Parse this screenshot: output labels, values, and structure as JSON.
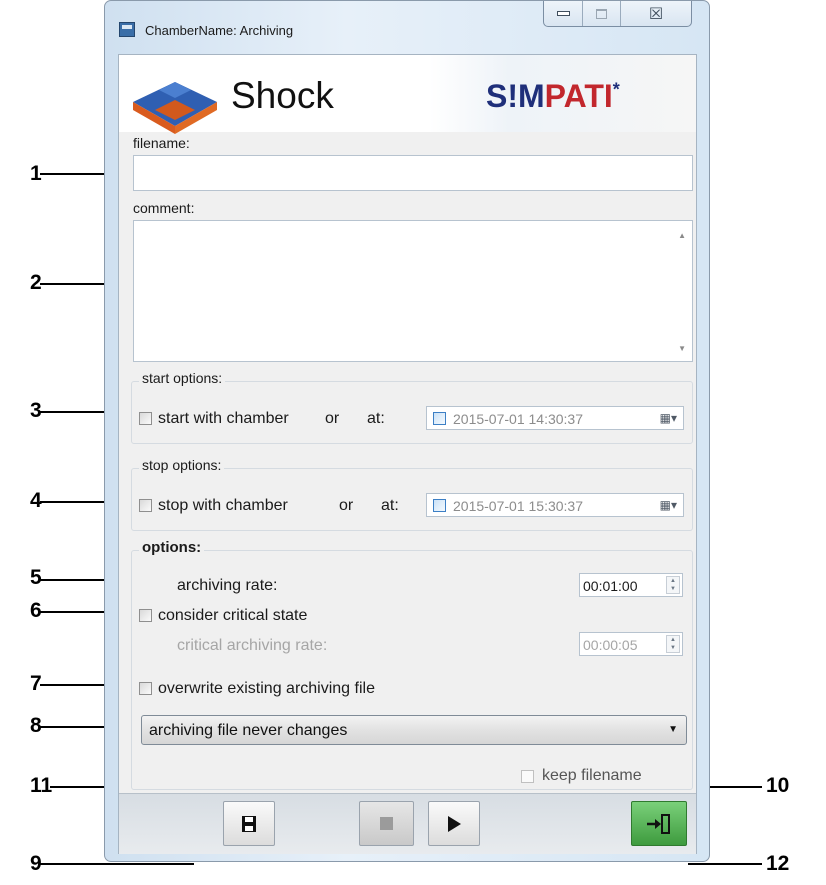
{
  "window": {
    "title": "ChamberName: Archiving",
    "icon": "floppy-window-icon",
    "controls": {
      "minimize": "minimize-icon",
      "maximize": "maximize-icon",
      "close_glyph": "☒"
    }
  },
  "banner": {
    "app_name": "Shock",
    "brand_part1": "S!M",
    "brand_part2": "PATI",
    "brand_mark": "*"
  },
  "fields": {
    "filename_label": "filename:",
    "filename_value": "",
    "comment_label": "comment:",
    "comment_value": ""
  },
  "start_options": {
    "title": "start options:",
    "checkbox_label": "start with chamber",
    "or_label": "or",
    "at_label": "at:",
    "datetime": "2015-07-01  14:30:37"
  },
  "stop_options": {
    "title": "stop options:",
    "checkbox_label": "stop with chamber",
    "or_label": "or",
    "at_label": "at:",
    "datetime": "2015-07-01 15:30:37"
  },
  "options": {
    "title": "options:",
    "archiving_rate_label": "archiving rate:",
    "archiving_rate_value": "00:01:00",
    "consider_critical_label": "consider critical state",
    "critical_rate_label": "critical archiving rate:",
    "critical_rate_value": "00:00:05",
    "overwrite_label": "overwrite existing archiving file",
    "file_mode_selected": "archiving file never changes",
    "keep_filename_label": "keep filename"
  },
  "toolbar": {
    "save_icon": "save-icon",
    "stop_icon": "stop-icon",
    "play_icon": "play-icon",
    "exit_icon": "exit-icon"
  },
  "callouts": [
    "1",
    "2",
    "3",
    "4",
    "5",
    "6",
    "7",
    "8",
    "9",
    "10",
    "11",
    "12"
  ]
}
